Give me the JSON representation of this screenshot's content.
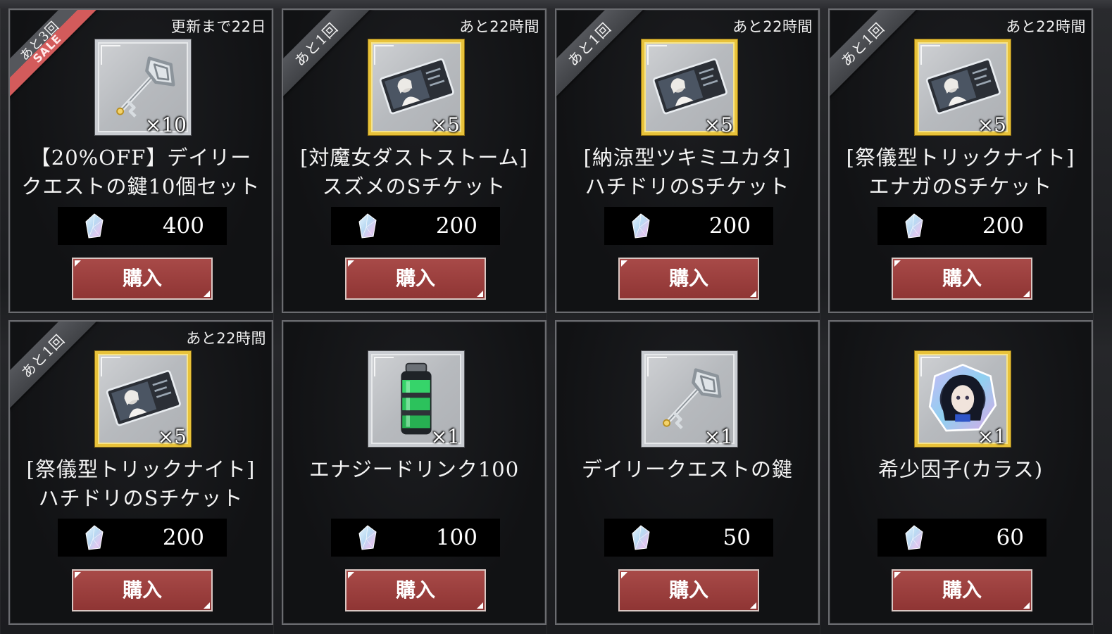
{
  "items": [
    {
      "ribbon": "あと3回",
      "sale_label": "SALE",
      "timer": "更新まで22日",
      "frame": "silver",
      "icon": "key-icon",
      "qty": "×10",
      "name_line1": "【20%OFF】デイリー",
      "name_line2": "クエストの鍵10個セット",
      "price": "400",
      "buy_label": "購入"
    },
    {
      "ribbon": "あと1回",
      "sale_label": "",
      "timer": "あと22時間",
      "frame": "gold",
      "icon": "ticket-icon",
      "qty": "×5",
      "name_line1": "[対魔女ダストストーム]",
      "name_line2": "スズメのSチケット",
      "price": "200",
      "buy_label": "購入"
    },
    {
      "ribbon": "あと1回",
      "sale_label": "",
      "timer": "あと22時間",
      "frame": "gold",
      "icon": "ticket-icon",
      "qty": "×5",
      "name_line1": "[納涼型ツキミユカタ]",
      "name_line2": "ハチドリのSチケット",
      "price": "200",
      "buy_label": "購入"
    },
    {
      "ribbon": "あと1回",
      "sale_label": "",
      "timer": "あと22時間",
      "frame": "gold",
      "icon": "ticket-icon",
      "qty": "×5",
      "name_line1": "[祭儀型トリックナイト]",
      "name_line2": "エナガのSチケット",
      "price": "200",
      "buy_label": "購入"
    },
    {
      "ribbon": "あと1回",
      "sale_label": "",
      "timer": "あと22時間",
      "frame": "gold",
      "icon": "ticket-icon",
      "qty": "×5",
      "name_line1": "[祭儀型トリックナイト]",
      "name_line2": "ハチドリのSチケット",
      "price": "200",
      "buy_label": "購入"
    },
    {
      "ribbon": "",
      "sale_label": "",
      "timer": "",
      "frame": "silver",
      "icon": "energy-drink-icon",
      "qty": "×1",
      "name_line1": "エナジードリンク100",
      "name_line2": "",
      "price": "100",
      "buy_label": "購入"
    },
    {
      "ribbon": "",
      "sale_label": "",
      "timer": "",
      "frame": "silver",
      "icon": "key-icon",
      "qty": "×1",
      "name_line1": "デイリークエストの鍵",
      "name_line2": "",
      "price": "50",
      "buy_label": "購入"
    },
    {
      "ribbon": "",
      "sale_label": "",
      "timer": "",
      "frame": "gold",
      "icon": "rare-factor-icon",
      "qty": "×1",
      "name_line1": "希少因子(カラス)",
      "name_line2": "",
      "price": "60",
      "buy_label": "購入"
    }
  ],
  "colors": {
    "button": "#993f3e",
    "gold_frame": "#e8c23a",
    "silver_frame": "#c9ccd1",
    "sale_ribbon": "#d35b5b",
    "ribbon": "#4a4c50"
  },
  "currency_icon": "crystal-gem-icon"
}
